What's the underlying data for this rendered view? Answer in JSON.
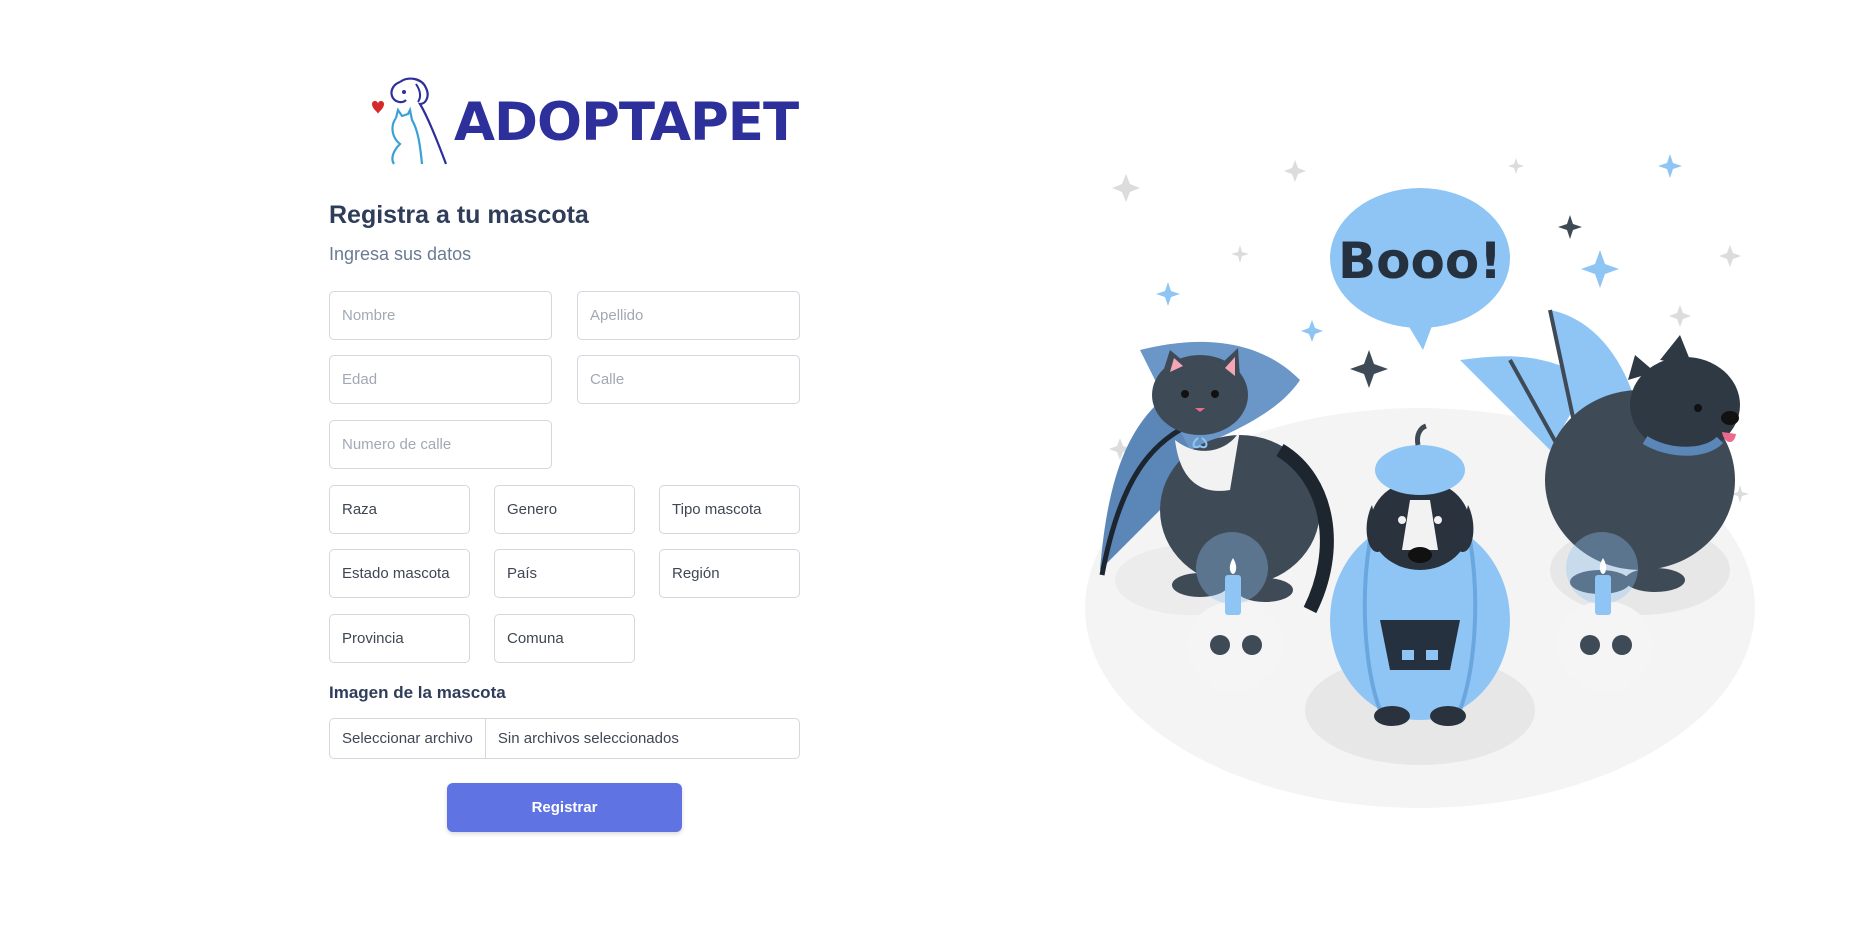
{
  "brand": {
    "name": "ADOPTAPET"
  },
  "form": {
    "title": "Registra a tu mascota",
    "subtitle": "Ingresa sus datos",
    "nombre_placeholder": "Nombre",
    "apellido_placeholder": "Apellido",
    "edad_placeholder": "Edad",
    "calle_placeholder": "Calle",
    "numero_placeholder": "Numero de calle",
    "selects": {
      "raza": "Raza",
      "genero": "Genero",
      "tipo": "Tipo mascota",
      "estado": "Estado mascota",
      "pais": "País",
      "region": "Región",
      "provincia": "Provincia",
      "comuna": "Comuna"
    },
    "image_label": "Imagen de la mascota",
    "file_button": "Seleccionar archivo",
    "file_status": "Sin archivos seleccionados",
    "submit": "Registrar"
  },
  "illustration": {
    "speech": "Booo!"
  },
  "colors": {
    "brand": "#2d2f9b",
    "accent": "#5f73e3",
    "illustration_blue": "#8ec5f5",
    "dark_pet": "#3f4a57"
  }
}
